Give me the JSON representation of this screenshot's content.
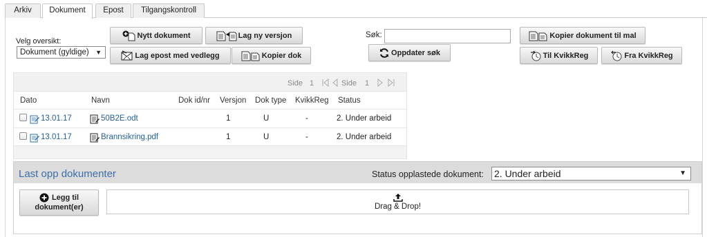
{
  "tabs": [
    "Arkiv",
    "Dokument",
    "Epost",
    "Tilgangskontroll"
  ],
  "active_tab": "Dokument",
  "overview": {
    "label": "Velg oversikt:",
    "selected": "Dokument (gyldige)"
  },
  "toolbar": {
    "new_document": "Nytt dokument",
    "new_version": "Lag ny versjon",
    "email_attachment": "Lag epost med vedlegg",
    "copy_doc": "Kopier dok",
    "copy_to_template": "Kopier dokument til mal",
    "to_kvikkreg": "Til KvikkReg",
    "from_kvikkreg": "Fra KvikkReg",
    "refresh_search": "Oppdater søk"
  },
  "search": {
    "label": "Søk:",
    "value": ""
  },
  "pager": {
    "page_label": "Side",
    "page_value": "1",
    "page_label_2": "Side",
    "page_value_2": "1"
  },
  "table": {
    "columns": [
      "Dato",
      "Navn",
      "Dok id/nr",
      "Versjon",
      "Dok type",
      "KvikkReg",
      "Status"
    ],
    "rows": [
      {
        "date": "13.01.17",
        "name": "50B2E.odt",
        "doc_id": "",
        "version": "1",
        "doc_type": "U",
        "kvikkreg": "-",
        "status": "2. Under arbeid"
      },
      {
        "date": "13.01.17",
        "name": "Brannsikring.pdf",
        "doc_id": "",
        "version": "1",
        "doc_type": "U",
        "kvikkreg": "-",
        "status": "2. Under arbeid"
      }
    ]
  },
  "upload": {
    "title": "Last opp dokumenter",
    "status_label": "Status opplastede dokument:",
    "status_selected": "2. Under arbeid",
    "add_button_line1": "Legg til",
    "add_button_line2": "dokument(er)",
    "drop_text": "Drag & Drop!"
  },
  "colors": {
    "link": "#1f5f9c",
    "title": "#3b6ea8"
  }
}
